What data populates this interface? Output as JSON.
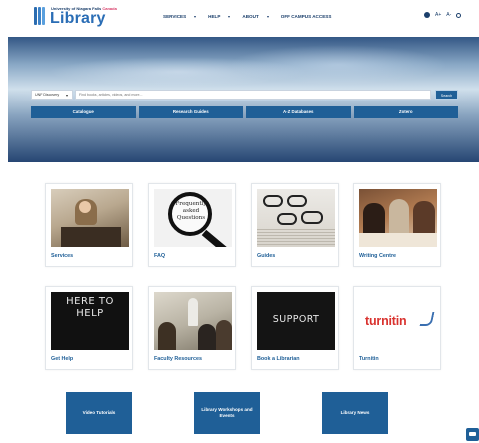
{
  "header": {
    "logo_sub_prefix": "University of Niagara Falls",
    "logo_sub_suffix": "Canada",
    "logo_main": "Library",
    "nav": [
      {
        "label": "SERVICES",
        "has_dropdown": true
      },
      {
        "label": "HELP",
        "has_dropdown": true
      },
      {
        "label": "ABOUT",
        "has_dropdown": true
      },
      {
        "label": "OFF CAMPUS ACCESS",
        "has_dropdown": false
      }
    ],
    "tools": {
      "icon_language": "globe-icon",
      "font_increase": "A+",
      "font_decrease": "A-",
      "icon_search": "search-icon"
    }
  },
  "hero": {
    "scope_select": "UNF Discovery",
    "search_placeholder": "Find books, articles, videos, and more...",
    "search_button": "Search",
    "quick_links": [
      "Catalogue",
      "Research Guides",
      "A-Z Databases",
      "Zotero"
    ]
  },
  "cards": [
    {
      "label": "Services",
      "image": "student-reading"
    },
    {
      "label": "FAQ",
      "image": "magnifying-glass",
      "image_text": "Frequently asked Questions"
    },
    {
      "label": "Guides",
      "image": "glasses-on-book"
    },
    {
      "label": "Writing Centre",
      "image": "students-writing"
    },
    {
      "label": "Get Help",
      "image": "chalkboard",
      "image_text": "HERE TO HELP"
    },
    {
      "label": "Faculty Resources",
      "image": "classroom"
    },
    {
      "label": "Book a Librarian",
      "image": "chalkboard",
      "image_text": "SUPPORT"
    },
    {
      "label": "Turnitin",
      "image": "turnitin-logo",
      "image_text": "turnitin"
    }
  ],
  "bottom_links": [
    "Video Tutorials",
    "Library Workshops and Events",
    "Library News"
  ],
  "chat": {
    "icon": "chat-icon"
  },
  "colors": {
    "brand_blue": "#1f5f97",
    "logo_blue": "#2a6db5",
    "turnitin_red": "#d9322e"
  }
}
